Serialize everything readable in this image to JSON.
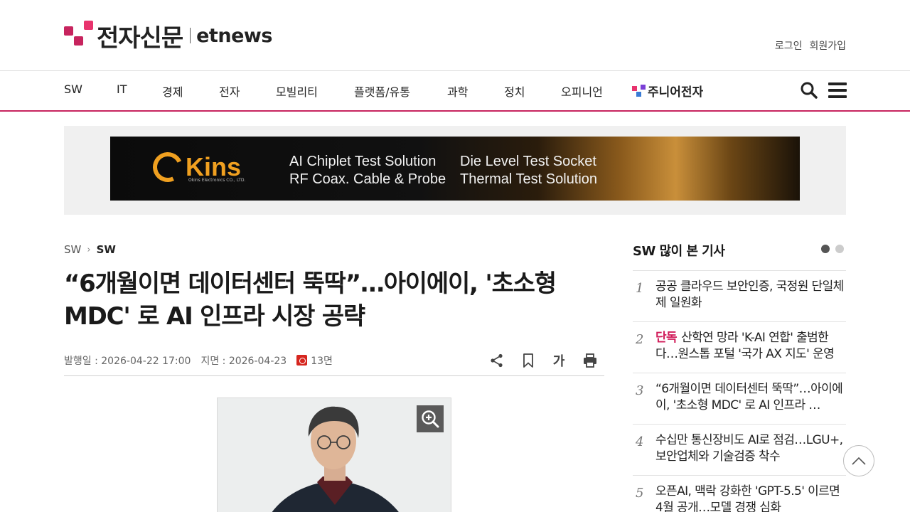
{
  "header": {
    "logo_ko": "전자신문",
    "logo_en": "etnews",
    "login": "로그인",
    "signup": "회원가입",
    "brand_colors": {
      "magenta": "#c7245e",
      "pink": "#e8336d"
    }
  },
  "nav": {
    "items": [
      "SW",
      "IT",
      "경제",
      "전자",
      "모빌리티",
      "플랫폼/유통",
      "과학",
      "정치",
      "오피니언",
      "주니어전자"
    ],
    "search_icon": "search-icon",
    "menu_icon": "hamburger-icon"
  },
  "ad": {
    "brand": "Kins",
    "brand_sub": "Okins Electronics CO., LTD.",
    "line1": "AI Chiplet Test Solution",
    "line2": "RF Coax. Cable & Probe",
    "line3": "Die Level Test Socket",
    "line4": "Thermal Test Solution"
  },
  "article": {
    "breadcrumb": [
      "SW",
      "SW"
    ],
    "title_line1": "“6개월이면 데이터센터 뚝딱”…아이에이, '초소형",
    "title_line2": "MDC' 로 AI 인프라 시장 공략",
    "published_label": "발행일 :",
    "published": "2026-04-22 17:00",
    "print_label": "지면 :",
    "print_date": "2026-04-23",
    "page": "13면",
    "font_size_label": "가"
  },
  "sidebar": {
    "title": "SW 많이 본 기사",
    "items": [
      {
        "rank": "1",
        "badge": "",
        "text": "공공 클라우드 보안인증, 국정원 단일체제 일원화"
      },
      {
        "rank": "2",
        "badge": "단독",
        "text": "산학연 망라 'K-AI 연합' 출범한다…원스톱 포털 '국가 AX 지도' 운영"
      },
      {
        "rank": "3",
        "badge": "",
        "text": "“6개월이면 데이터센터 뚝딱”…아이에이, '초소형 MDC' 로 AI 인프라 …"
      },
      {
        "rank": "4",
        "badge": "",
        "text": "수십만 통신장비도 AI로 점검…LGU+, 보안업체와 기술검증 착수"
      },
      {
        "rank": "5",
        "badge": "",
        "text": "오픈AI, 맥락 강화한 'GPT-5.5' 이르면 4월 공개…모델 경쟁 심화"
      }
    ]
  }
}
